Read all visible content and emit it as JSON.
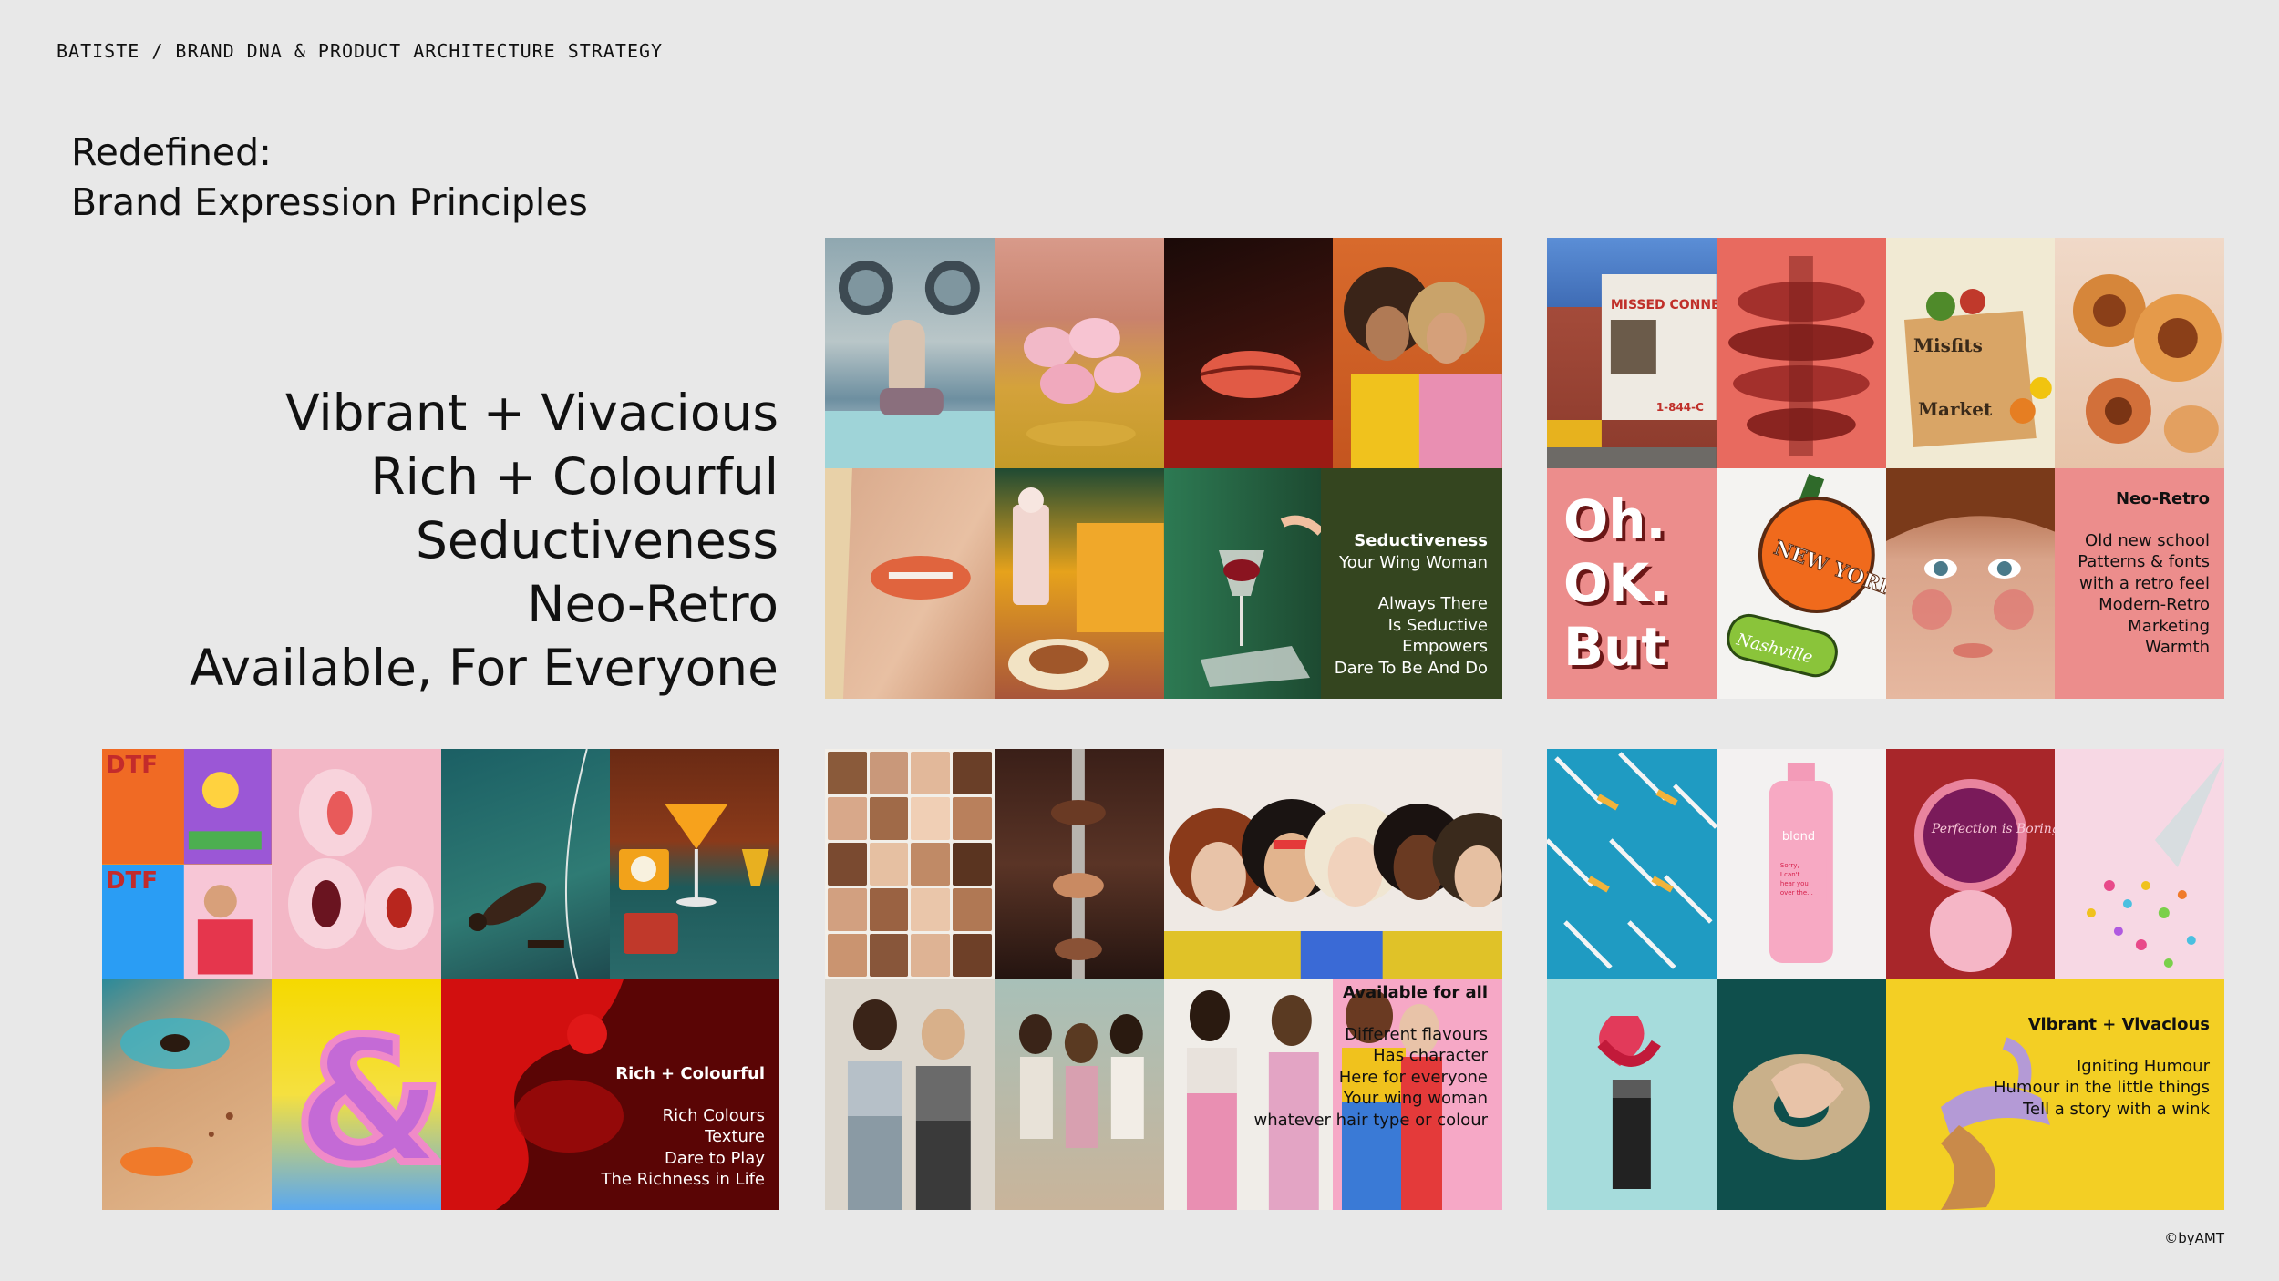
{
  "header": {
    "breadcrumb": "BATISTE / BRAND DNA & PRODUCT ARCHITECTURE STRATEGY"
  },
  "title": {
    "line1": "Redefined:",
    "line2": "Brand Expression Principles"
  },
  "principles": [
    "Vibrant + Vivacious",
    "Rich + Colourful",
    "Seductiveness",
    "Neo-Retro",
    "Available, For Everyone"
  ],
  "panels": {
    "seductiveness": {
      "heading": "Seductiveness",
      "subheading": "Your Wing Woman",
      "lines": [
        "Always There",
        "Is Seductive",
        "Empowers",
        "Dare To Be And Do"
      ]
    },
    "neo_retro": {
      "heading": "Neo-Retro",
      "lines": [
        "Old new school",
        "Patterns & fonts",
        "with a retro feel",
        "Modern-Retro",
        "Marketing",
        "Warmth"
      ],
      "sign_text": "MISSED CONNE",
      "sign_phone": "1-844-C",
      "box_label_1": "Misfits",
      "box_label_2": "Market",
      "sticker_text": "Oh. OK. But",
      "apple_text": "NEW YORK",
      "nashville_text": "Nashville"
    },
    "rich_colourful": {
      "heading": "Rich + Colourful",
      "lines": [
        "Rich Colours",
        "Texture",
        "Dare to Play",
        "The Richness in Life"
      ],
      "poster_text": "DTF"
    },
    "available": {
      "heading": "Available for all",
      "lines": [
        "Different flavours",
        "Has character",
        "Here for everyone",
        "Your wing woman",
        "whatever hair type or colour"
      ]
    },
    "vibrant": {
      "heading": "Vibrant + Vivacious",
      "lines": [
        "Igniting Humour",
        "Humour in the little things",
        "Tell a story with a wink"
      ],
      "bottle_brand": "blond",
      "bottle_text": "Sorry, I can't hear you over the volume of my hair",
      "compact_text": "Perfection is Boring"
    }
  },
  "footer": {
    "credit": "©byAMT"
  }
}
